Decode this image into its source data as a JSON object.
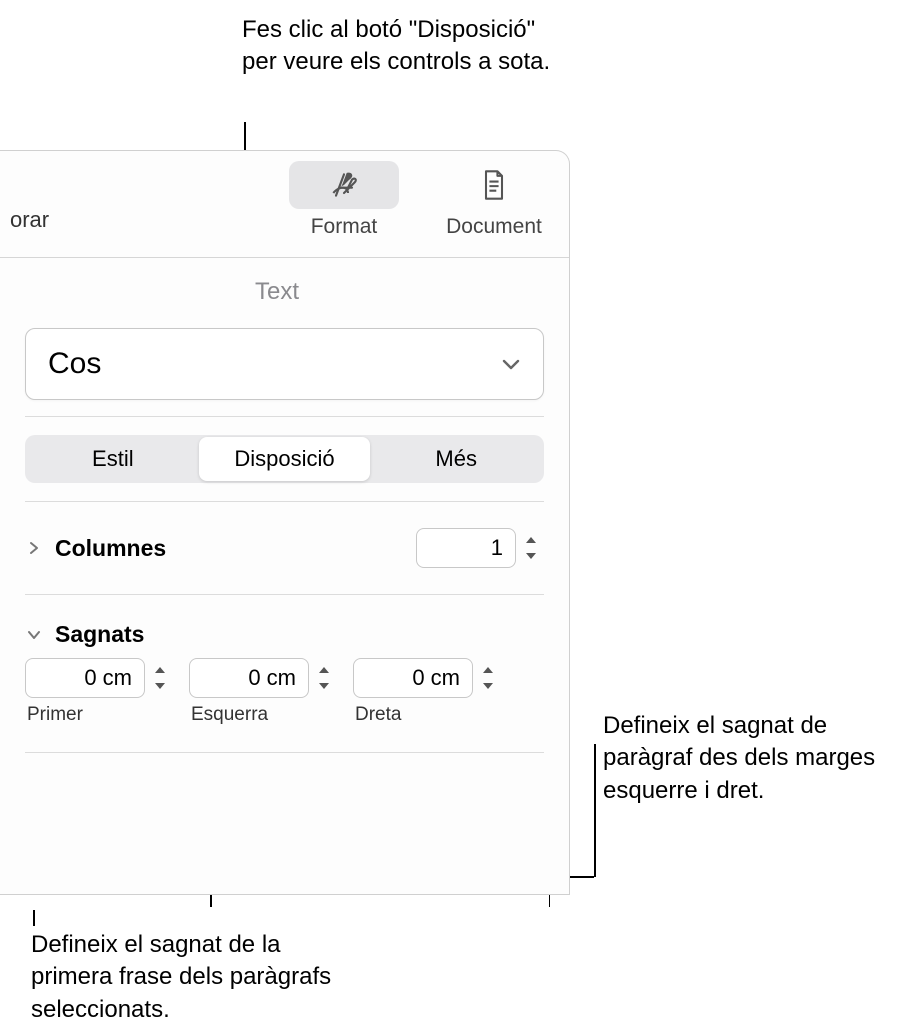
{
  "callouts": {
    "top": "Fes clic al botó \"Disposició\" per veure els controls a sota.",
    "right": "Defineix el sagnat de paràgraf des dels marges esquerre i dret.",
    "bottom": "Defineix el sagnat de la primera frase dels paràgrafs seleccionats."
  },
  "toolbar": {
    "partial": "orar",
    "format": "Format",
    "document": "Document"
  },
  "panel": {
    "text_label": "Text",
    "style_name": "Cos",
    "tabs": {
      "estil": "Estil",
      "disposicio": "Disposició",
      "mes": "Més"
    },
    "columns": {
      "label": "Columnes",
      "value": "1"
    },
    "indents": {
      "label": "Sagnats",
      "first_label": "Primer",
      "left_label": "Esquerra",
      "right_label": "Dreta",
      "first_value": "0 cm",
      "left_value": "0 cm",
      "right_value": "0 cm"
    }
  }
}
